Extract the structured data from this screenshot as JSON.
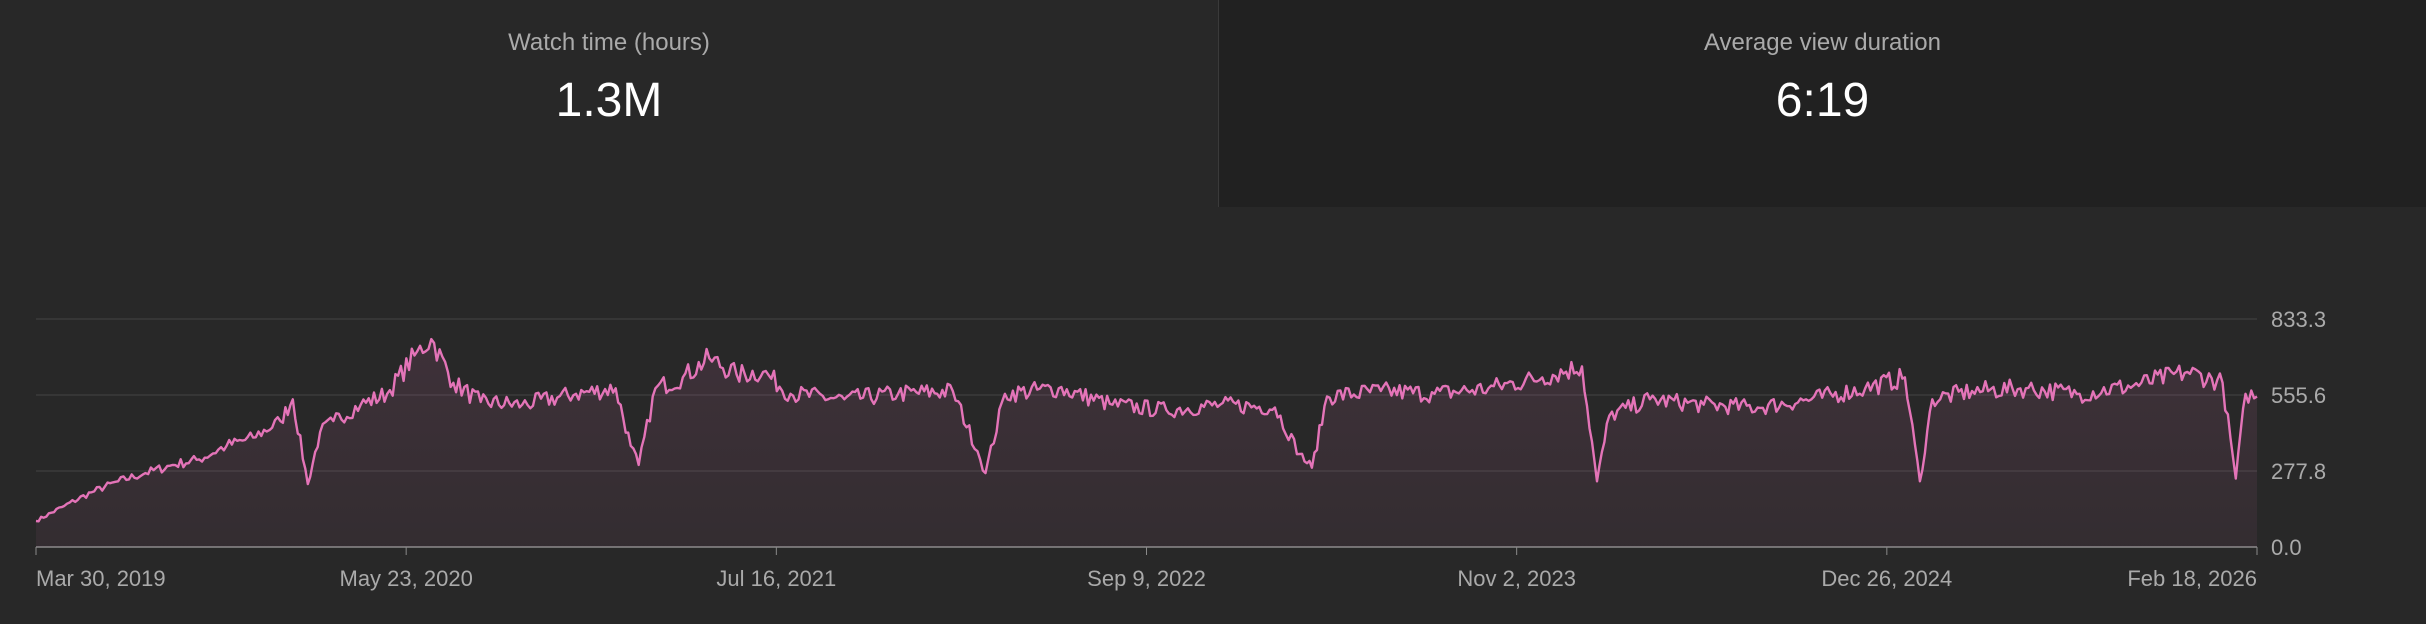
{
  "metrics": [
    {
      "label": "Watch time (hours)",
      "value": "1.3M"
    },
    {
      "label": "Average view duration",
      "value": "6:19"
    }
  ],
  "colors": {
    "line": "#e474b8",
    "background": "#282828",
    "card_alt_background": "#212121",
    "grid": "#444444",
    "label": "#aaaaaa"
  },
  "chart_data": {
    "type": "area",
    "x_ticks": [
      "Mar 30, 2019",
      "May 23, 2020",
      "Jul 16, 2021",
      "Sep 9, 2022",
      "Nov 2, 2023",
      "Dec 26, 2024",
      "Feb 18, 2026"
    ],
    "y_ticks": [
      "833.3",
      "555.6",
      "277.8",
      "0.0"
    ],
    "ylim": [
      0,
      833.3
    ],
    "xlim": [
      "2019-03-30",
      "2026-02-18"
    ],
    "grid": true,
    "series": [
      {
        "values": [
          [
            "2019-03-30",
            95
          ],
          [
            "2019-05-01",
            150
          ],
          [
            "2019-06-01",
            200
          ],
          [
            "2019-07-01",
            240
          ],
          [
            "2019-08-01",
            270
          ],
          [
            "2019-09-01",
            300
          ],
          [
            "2019-10-01",
            320
          ],
          [
            "2019-11-01",
            370
          ],
          [
            "2019-12-01",
            400
          ],
          [
            "2020-01-01",
            460
          ],
          [
            "2020-01-15",
            540
          ],
          [
            "2020-02-01",
            230
          ],
          [
            "2020-02-15",
            420
          ],
          [
            "2020-03-01",
            460
          ],
          [
            "2020-04-01",
            520
          ],
          [
            "2020-05-01",
            560
          ],
          [
            "2020-06-01",
            700
          ],
          [
            "2020-06-20",
            760
          ],
          [
            "2020-07-15",
            600
          ],
          [
            "2020-08-15",
            530
          ],
          [
            "2020-10-01",
            520
          ],
          [
            "2020-12-01",
            560
          ],
          [
            "2021-01-15",
            580
          ],
          [
            "2021-02-01",
            370
          ],
          [
            "2021-02-10",
            300
          ],
          [
            "2021-03-01",
            580
          ],
          [
            "2021-04-01",
            620
          ],
          [
            "2021-05-01",
            690
          ],
          [
            "2021-06-01",
            630
          ],
          [
            "2021-07-01",
            640
          ],
          [
            "2021-08-01",
            560
          ],
          [
            "2021-10-01",
            540
          ],
          [
            "2021-12-01",
            560
          ],
          [
            "2022-02-01",
            570
          ],
          [
            "2022-03-01",
            350
          ],
          [
            "2022-03-10",
            270
          ],
          [
            "2022-04-01",
            560
          ],
          [
            "2022-06-01",
            580
          ],
          [
            "2022-08-01",
            520
          ],
          [
            "2022-10-01",
            500
          ],
          [
            "2022-12-01",
            520
          ],
          [
            "2023-02-01",
            510
          ],
          [
            "2023-03-01",
            340
          ],
          [
            "2023-03-15",
            290
          ],
          [
            "2023-04-01",
            550
          ],
          [
            "2023-06-01",
            570
          ],
          [
            "2023-08-01",
            560
          ],
          [
            "2023-10-01",
            580
          ],
          [
            "2023-12-01",
            620
          ],
          [
            "2024-01-15",
            660
          ],
          [
            "2024-02-01",
            240
          ],
          [
            "2024-02-15",
            480
          ],
          [
            "2024-04-01",
            540
          ],
          [
            "2024-06-01",
            520
          ],
          [
            "2024-08-01",
            510
          ],
          [
            "2024-10-01",
            540
          ],
          [
            "2024-12-01",
            580
          ],
          [
            "2025-01-15",
            620
          ],
          [
            "2025-02-01",
            240
          ],
          [
            "2025-02-15",
            540
          ],
          [
            "2025-04-01",
            570
          ],
          [
            "2025-06-01",
            580
          ],
          [
            "2025-08-01",
            560
          ],
          [
            "2025-10-01",
            590
          ],
          [
            "2025-12-01",
            640
          ],
          [
            "2026-01-10",
            600
          ],
          [
            "2026-01-25",
            250
          ],
          [
            "2026-02-05",
            560
          ],
          [
            "2026-02-18",
            550
          ]
        ]
      }
    ]
  }
}
